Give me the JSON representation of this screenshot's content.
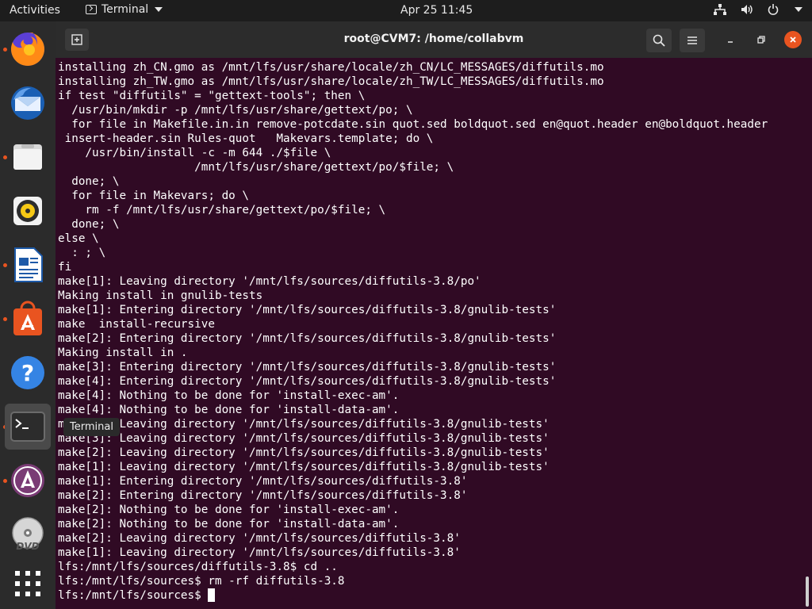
{
  "topbar": {
    "activities": "Activities",
    "app_menu": "Terminal",
    "clock": "Apr 25  11:45"
  },
  "dock": {
    "tooltip": "Terminal",
    "items": [
      {
        "name": "firefox-icon"
      },
      {
        "name": "thunderbird-icon"
      },
      {
        "name": "files-icon"
      },
      {
        "name": "rhythmbox-icon"
      },
      {
        "name": "libreoffice-writer-icon"
      },
      {
        "name": "software-center-icon"
      },
      {
        "name": "help-icon"
      },
      {
        "name": "terminal-icon"
      },
      {
        "name": "software-updater-icon"
      },
      {
        "name": "dvd-icon"
      },
      {
        "name": "show-applications-icon"
      }
    ]
  },
  "window": {
    "title": "root@CVM7: /home/collabvm"
  },
  "terminal": {
    "lines": [
      "installing zh_CN.gmo as /mnt/lfs/usr/share/locale/zh_CN/LC_MESSAGES/diffutils.mo",
      "installing zh_TW.gmo as /mnt/lfs/usr/share/locale/zh_TW/LC_MESSAGES/diffutils.mo",
      "if test \"diffutils\" = \"gettext-tools\"; then \\",
      "  /usr/bin/mkdir -p /mnt/lfs/usr/share/gettext/po; \\",
      "  for file in Makefile.in.in remove-potcdate.sin quot.sed boldquot.sed en@quot.header en@boldquot.header",
      " insert-header.sin Rules-quot   Makevars.template; do \\",
      "    /usr/bin/install -c -m 644 ./$file \\",
      "                    /mnt/lfs/usr/share/gettext/po/$file; \\",
      "  done; \\",
      "  for file in Makevars; do \\",
      "    rm -f /mnt/lfs/usr/share/gettext/po/$file; \\",
      "  done; \\",
      "else \\",
      "  : ; \\",
      "fi",
      "make[1]: Leaving directory '/mnt/lfs/sources/diffutils-3.8/po'",
      "Making install in gnulib-tests",
      "make[1]: Entering directory '/mnt/lfs/sources/diffutils-3.8/gnulib-tests'",
      "make  install-recursive",
      "make[2]: Entering directory '/mnt/lfs/sources/diffutils-3.8/gnulib-tests'",
      "Making install in .",
      "make[3]: Entering directory '/mnt/lfs/sources/diffutils-3.8/gnulib-tests'",
      "make[4]: Entering directory '/mnt/lfs/sources/diffutils-3.8/gnulib-tests'",
      "make[4]: Nothing to be done for 'install-exec-am'.",
      "make[4]: Nothing to be done for 'install-data-am'.",
      "make[4]: Leaving directory '/mnt/lfs/sources/diffutils-3.8/gnulib-tests'",
      "make[3]: Leaving directory '/mnt/lfs/sources/diffutils-3.8/gnulib-tests'",
      "make[2]: Leaving directory '/mnt/lfs/sources/diffutils-3.8/gnulib-tests'",
      "make[1]: Leaving directory '/mnt/lfs/sources/diffutils-3.8/gnulib-tests'",
      "make[1]: Entering directory '/mnt/lfs/sources/diffutils-3.8'",
      "make[2]: Entering directory '/mnt/lfs/sources/diffutils-3.8'",
      "make[2]: Nothing to be done for 'install-exec-am'.",
      "make[2]: Nothing to be done for 'install-data-am'.",
      "make[2]: Leaving directory '/mnt/lfs/sources/diffutils-3.8'",
      "make[1]: Leaving directory '/mnt/lfs/sources/diffutils-3.8'",
      "lfs:/mnt/lfs/sources/diffutils-3.8$ cd ..",
      "lfs:/mnt/lfs/sources$ rm -rf diffutils-3.8"
    ],
    "prompt": "lfs:/mnt/lfs/sources$ "
  },
  "colors": {
    "terminal_bg": "#300a24",
    "accent": "#e95420"
  }
}
